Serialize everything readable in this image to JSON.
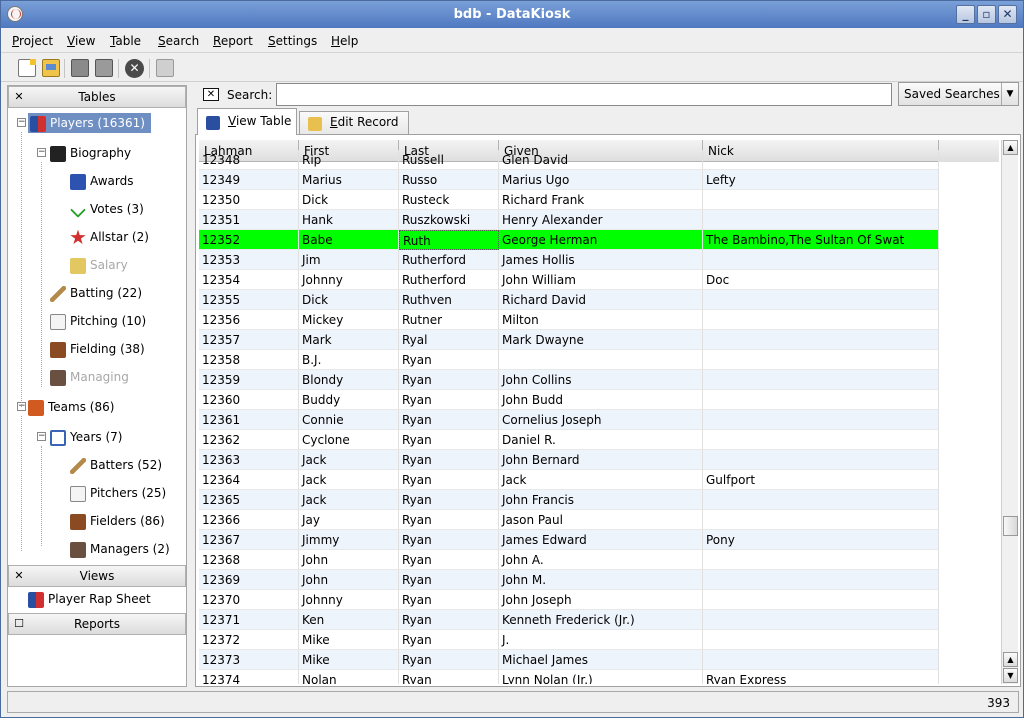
{
  "window": {
    "title": "bdb - DataKiosk"
  },
  "menu": [
    {
      "pre": "",
      "u": "P",
      "post": "roject"
    },
    {
      "pre": "",
      "u": "V",
      "post": "iew"
    },
    {
      "pre": "",
      "u": "T",
      "post": "able"
    },
    {
      "pre": "",
      "u": "S",
      "post": "earch"
    },
    {
      "pre": "",
      "u": "R",
      "post": "eport"
    },
    {
      "pre": "",
      "u": "S",
      "post": "ettings"
    },
    {
      "pre": "",
      "u": "H",
      "post": "elp"
    }
  ],
  "sidebar": {
    "tables_header": "Tables",
    "views_header": "Views",
    "reports_header": "Reports",
    "tree": [
      {
        "label": "Players (16361)",
        "icon": "players-icon"
      },
      {
        "label": "Biography",
        "icon": "biography-icon"
      },
      {
        "label": "Awards",
        "icon": "award-icon"
      },
      {
        "label": "Votes (3)",
        "icon": "checkmark-icon"
      },
      {
        "label": "Allstar (2)",
        "icon": "star-icon"
      },
      {
        "label": "Salary",
        "icon": "coin-icon"
      },
      {
        "label": "Batting (22)",
        "icon": "bat-icon"
      },
      {
        "label": "Pitching (10)",
        "icon": "baseball-icon"
      },
      {
        "label": "Fielding (38)",
        "icon": "glove-icon"
      },
      {
        "label": "Managing",
        "icon": "manager-icon"
      },
      {
        "label": "Teams (86)",
        "icon": "teams-icon"
      },
      {
        "label": "Years (7)",
        "icon": "clock-icon"
      },
      {
        "label": "Batters (52)",
        "icon": "bat-icon"
      },
      {
        "label": "Pitchers (25)",
        "icon": "baseball-icon"
      },
      {
        "label": "Fielders (86)",
        "icon": "glove-icon"
      },
      {
        "label": "Managers (2)",
        "icon": "manager-icon"
      }
    ],
    "views": [
      {
        "label": "Player Rap Sheet",
        "icon": "players-icon"
      }
    ]
  },
  "search": {
    "label": "Search:",
    "value": "",
    "saved_label": "Saved Searches"
  },
  "tabs": [
    {
      "u": "V",
      "post": "iew Table"
    },
    {
      "u": "E",
      "post": "dit Record"
    }
  ],
  "table": {
    "columns": [
      "Lahman",
      "First",
      "Last",
      "Given",
      "Nick"
    ],
    "rows": [
      [
        "12348",
        "Rip",
        "Russell",
        "Glen David",
        ""
      ],
      [
        "12349",
        "Marius",
        "Russo",
        "Marius Ugo",
        "Lefty"
      ],
      [
        "12350",
        "Dick",
        "Rusteck",
        "Richard Frank",
        ""
      ],
      [
        "12351",
        "Hank",
        "Ruszkowski",
        "Henry Alexander",
        ""
      ],
      [
        "12352",
        "Babe",
        "Ruth",
        "George Herman",
        "The Bambino,The Sultan Of Swat"
      ],
      [
        "12353",
        "Jim",
        "Rutherford",
        "James Hollis",
        ""
      ],
      [
        "12354",
        "Johnny",
        "Rutherford",
        "John William",
        "Doc"
      ],
      [
        "12355",
        "Dick",
        "Ruthven",
        "Richard David",
        ""
      ],
      [
        "12356",
        "Mickey",
        "Rutner",
        "Milton",
        ""
      ],
      [
        "12357",
        "Mark",
        "Ryal",
        "Mark Dwayne",
        ""
      ],
      [
        "12358",
        "B.J.",
        "Ryan",
        "",
        ""
      ],
      [
        "12359",
        "Blondy",
        "Ryan",
        "John Collins",
        ""
      ],
      [
        "12360",
        "Buddy",
        "Ryan",
        "John Budd",
        ""
      ],
      [
        "12361",
        "Connie",
        "Ryan",
        "Cornelius Joseph",
        ""
      ],
      [
        "12362",
        "Cyclone",
        "Ryan",
        "Daniel R.",
        ""
      ],
      [
        "12363",
        "Jack",
        "Ryan",
        "John Bernard",
        ""
      ],
      [
        "12364",
        "Jack",
        "Ryan",
        "Jack",
        "Gulfport"
      ],
      [
        "12365",
        "Jack",
        "Ryan",
        "John Francis",
        ""
      ],
      [
        "12366",
        "Jay",
        "Ryan",
        "Jason Paul",
        ""
      ],
      [
        "12367",
        "Jimmy",
        "Ryan",
        "James Edward",
        "Pony"
      ],
      [
        "12368",
        "John",
        "Ryan",
        "John A.",
        ""
      ],
      [
        "12369",
        "John",
        "Ryan",
        "John M.",
        ""
      ],
      [
        "12370",
        "Johnny",
        "Ryan",
        "John Joseph",
        ""
      ],
      [
        "12371",
        "Ken",
        "Ryan",
        "Kenneth Frederick (Jr.)",
        ""
      ],
      [
        "12372",
        "Mike",
        "Ryan",
        "J.",
        ""
      ],
      [
        "12373",
        "Mike",
        "Ryan",
        "Michael James",
        ""
      ],
      [
        "12374",
        "Nolan",
        "Ryan",
        "Lynn Nolan (Jr.)",
        "Ryan Express"
      ]
    ],
    "highlight_row": 4
  },
  "status": {
    "count": "393"
  },
  "colors": {
    "highlight": "#00ff00",
    "selection": "#6f8fc2",
    "titlebar": "#5a82c8"
  }
}
